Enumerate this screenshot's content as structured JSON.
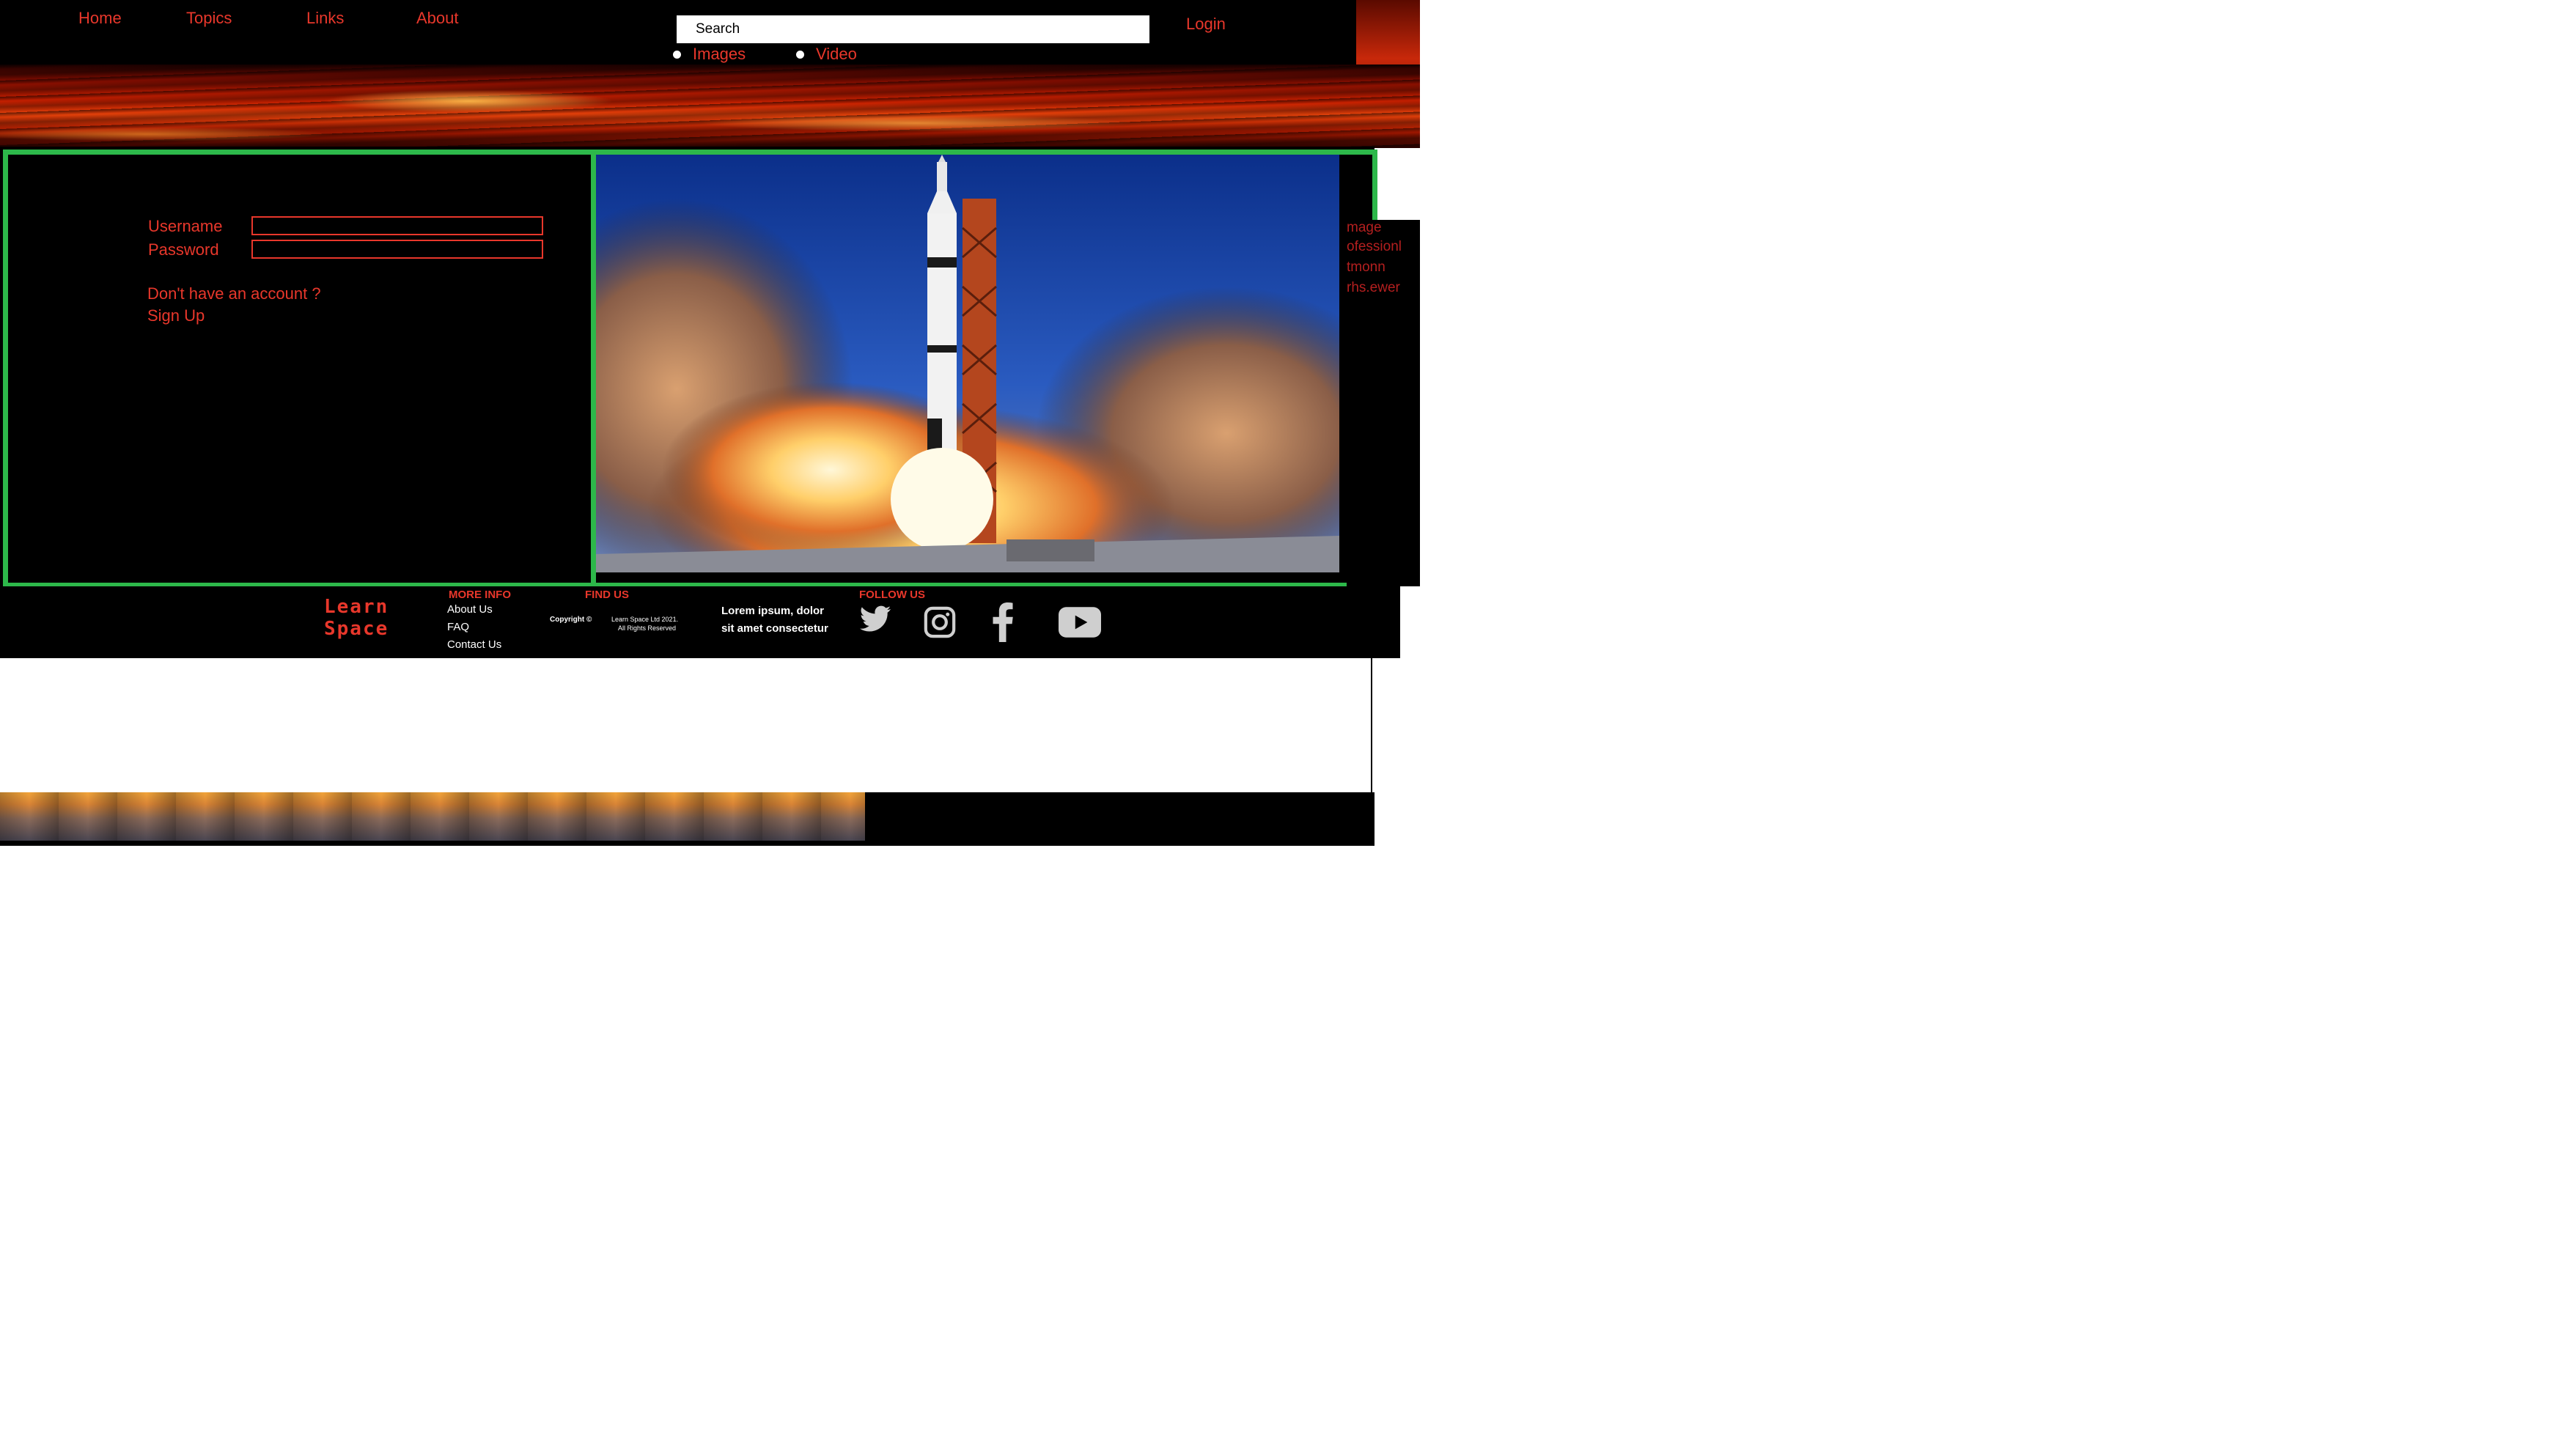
{
  "nav": {
    "items": [
      {
        "label": "Home"
      },
      {
        "label": "Topics"
      },
      {
        "label": "Links"
      },
      {
        "label": "About"
      }
    ],
    "login_label": "Login"
  },
  "search": {
    "placeholder": "Search",
    "options": [
      {
        "label": "Images"
      },
      {
        "label": "Video"
      }
    ]
  },
  "login_form": {
    "username_label": "Username",
    "password_label": "Password",
    "username_value": "",
    "password_value": "",
    "no_account_text": "Don't have an account ?",
    "signup_label": "Sign Up"
  },
  "side_text": [
    "mage",
    "ofessionl",
    "tmonn",
    "rhs.ewer"
  ],
  "footer": {
    "brand_line1": "Learn",
    "brand_line2": "Space",
    "more_info_heading": "MORE INFO",
    "more_info_links": [
      "About Us",
      "FAQ",
      "Contact Us"
    ],
    "find_us_heading": "FIND US",
    "copyright_label": "Copyright ©",
    "copyright_company": "Learn Space Ltd 2021.",
    "copyright_rights": "All Rights Reserved",
    "lorem_line1": "Lorem ipsum, dolor",
    "lorem_line2": "sit amet consectetur",
    "follow_heading": "FOLLOW US",
    "social": [
      "twitter-icon",
      "instagram-icon",
      "facebook-icon",
      "youtube-icon"
    ]
  },
  "colors": {
    "accent_red": "#e8372b",
    "frame_green": "#2db84a",
    "background": "#000000"
  }
}
